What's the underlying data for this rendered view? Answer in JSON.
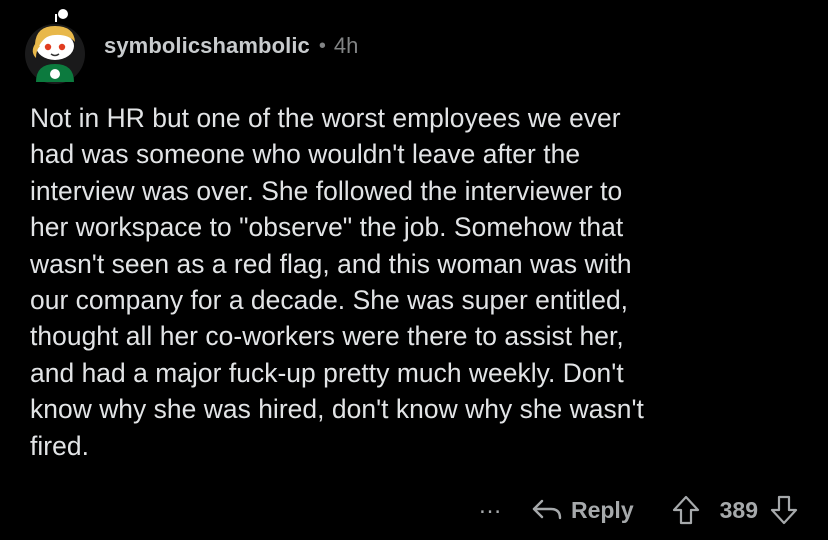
{
  "comment": {
    "author": "symbolicshambolic",
    "separator": "•",
    "age": "4h",
    "body": "Not in HR but one of the worst employees we ever\nhad was someone who wouldn't leave after the\ninterview was over. She followed the interviewer to\nher workspace to \"observe\" the job. Somehow that\nwasn't seen as a red flag, and this woman was with\nour company for a decade. She was super entitled,\nthought all her co-workers were there to assist her,\nand had a major fuck-up pretty much weekly. Don't\nknow why she was hired, don't know why she wasn't\nfired."
  },
  "actions": {
    "more_label": "…",
    "reply_label": "Reply",
    "score": "389"
  },
  "icons": {
    "avatar": "avatar-icon",
    "reply": "reply-arrow-icon",
    "upvote": "upvote-arrow-icon",
    "downvote": "downvote-arrow-icon"
  },
  "colors": {
    "background": "#000000",
    "text": "#e2e4e6",
    "meta": "#818384",
    "actions": "#a6a9ab"
  }
}
